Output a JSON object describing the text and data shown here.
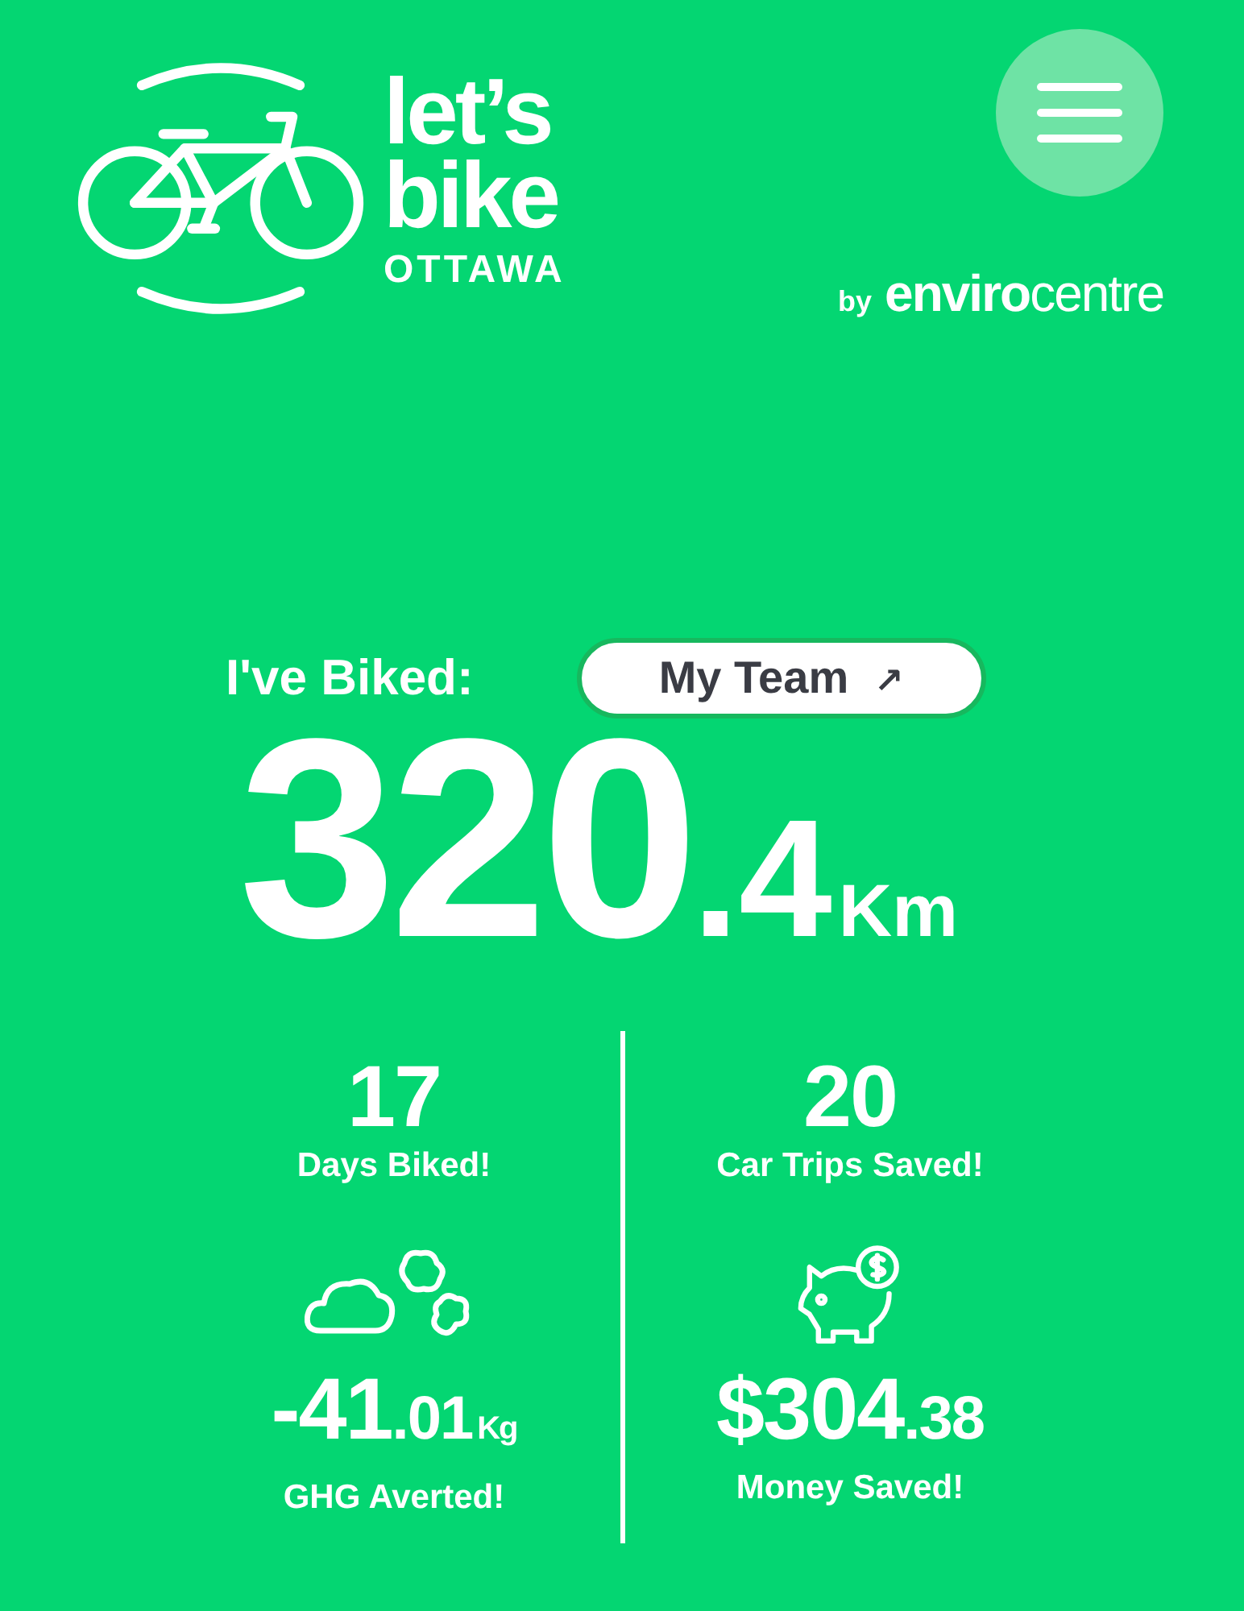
{
  "header": {
    "logo": {
      "line_1": "let’s",
      "line_2": "bike",
      "line_3": "OTTAWA"
    },
    "byline": {
      "prefix": "by",
      "brand_bold": "enviro",
      "brand_light": "centre"
    }
  },
  "summary": {
    "label": "I've Biked:",
    "team_button": {
      "label": "My Team",
      "icon": "↗"
    },
    "distance": {
      "whole": "320",
      "fraction": ".4",
      "unit": "Km"
    }
  },
  "stats": [
    {
      "kind": "count",
      "value": "17",
      "label": "Days Biked!"
    },
    {
      "kind": "count",
      "value": "20",
      "label": "Car Trips Saved!"
    },
    {
      "kind": "emissions",
      "whole": "-41",
      "fraction": ".01",
      "unit": "Kg",
      "label": "GHG Averted!"
    },
    {
      "kind": "money",
      "whole": "$304",
      "fraction": ".38",
      "label": "Money Saved!"
    }
  ]
}
